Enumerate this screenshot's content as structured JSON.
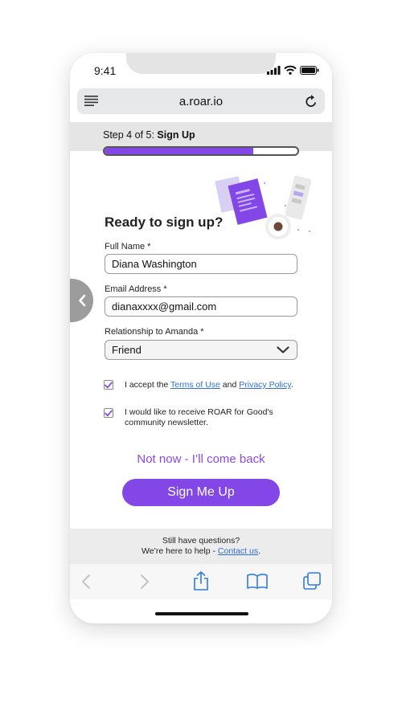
{
  "status_bar": {
    "time": "9:41"
  },
  "browser": {
    "url": "a.roar.io"
  },
  "progress": {
    "step_prefix": "Step 4 of 5: ",
    "step_name": "Sign Up",
    "fraction": 0.77
  },
  "form": {
    "heading": "Ready to sign up?",
    "full_name": {
      "label": "Full Name *",
      "value": "Diana Washington"
    },
    "email": {
      "label": "Email Address *",
      "value": "dianaxxxx@gmail.com"
    },
    "relationship": {
      "label": "Relationship to Amanda *",
      "selected": "Friend"
    },
    "terms": {
      "checked": true,
      "prefix": "I accept the ",
      "terms_link": "Terms of Use",
      "middle": " and ",
      "privacy_link": "Privacy Policy",
      "suffix": "."
    },
    "newsletter": {
      "checked": true,
      "line1": "I would like to receive ROAR for Good's",
      "line2": "community newsletter."
    },
    "not_now_label": "Not now - I’ll come back",
    "submit_label": "Sign Me Up"
  },
  "help": {
    "line1": "Still have questions?",
    "line2_prefix": "We’re here to help - ",
    "contact_link": "Contact us",
    "line2_suffix": "."
  },
  "colors": {
    "accent": "#8247e6",
    "link": "#2f6fd6",
    "toolbar_icon": "#2f7ae5",
    "toolbar_disabled": "#c4c4c4"
  },
  "icons": {
    "status": [
      "signal-icon",
      "wifi-icon",
      "battery-icon"
    ],
    "browser": [
      "menu-icon",
      "reload-icon"
    ],
    "toolbar": [
      "back-icon",
      "forward-icon",
      "share-icon",
      "bookmarks-icon",
      "tabs-icon"
    ]
  }
}
